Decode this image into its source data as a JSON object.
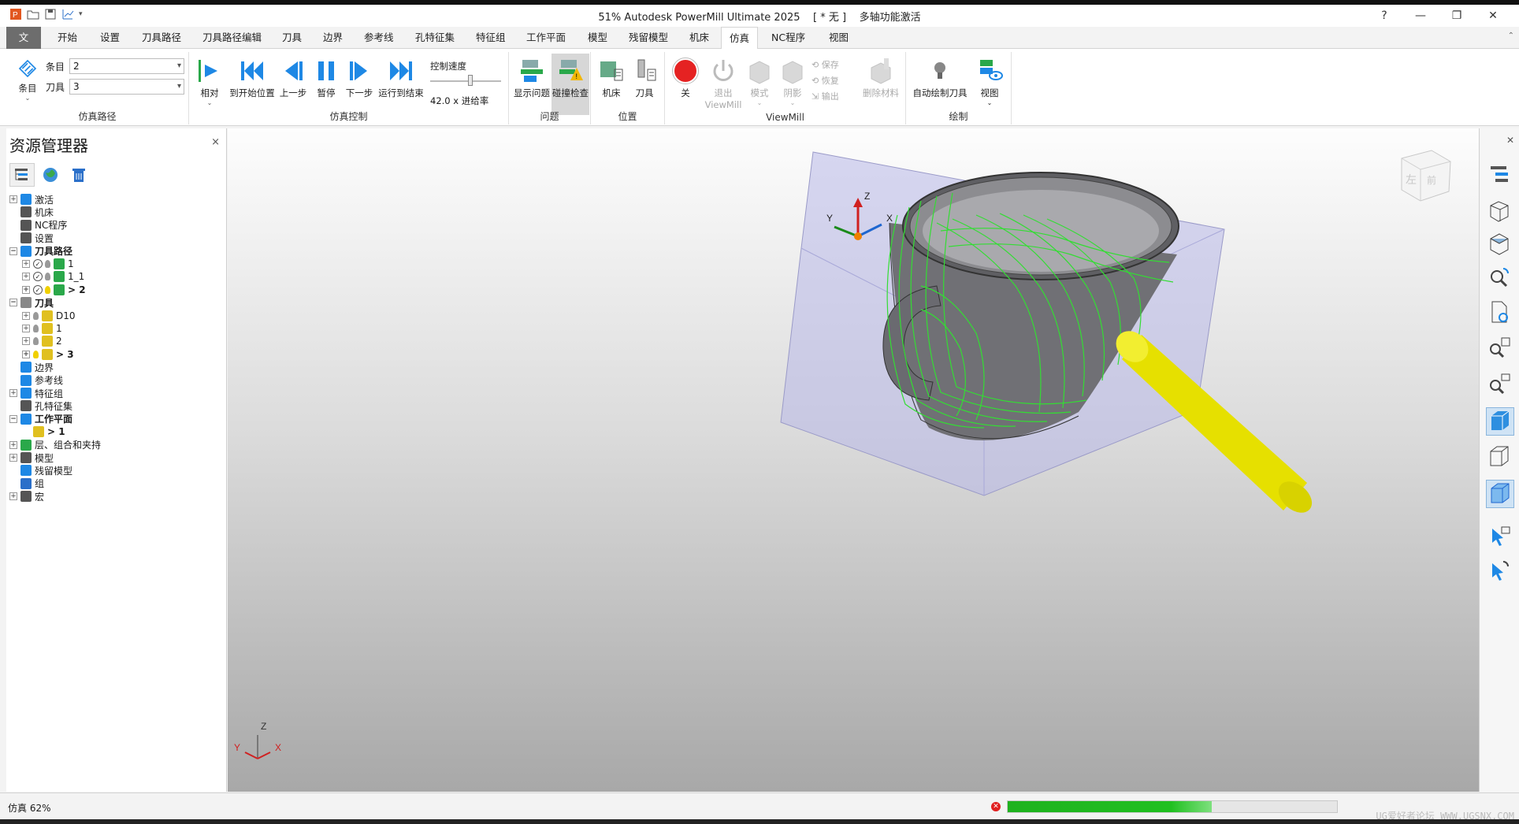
{
  "window": {
    "title": "51% Autodesk PowerMill Ultimate 2025",
    "project": "[ * 无 ]",
    "mode": "多轴功能激活",
    "controls": [
      "?",
      "—",
      "❐",
      "✕"
    ]
  },
  "tabs": [
    "文件",
    "开始",
    "设置",
    "刀具路径",
    "刀具路径编辑",
    "刀具",
    "边界",
    "参考线",
    "孔特征集",
    "特征组",
    "工作平面",
    "模型",
    "残留模型",
    "机床",
    "仿真",
    "NC程序",
    "视图"
  ],
  "active_tab": "仿真",
  "ribbon": {
    "sim_path": {
      "label": "仿真路径",
      "entity_button": "条目",
      "entity_label": "条目",
      "entity_value": "2",
      "tool_label": "刀具",
      "tool_value": "3"
    },
    "sim_control": {
      "label": "仿真控制",
      "relative": "相对",
      "to_start": "到开始位置",
      "prev": "上一步",
      "pause": "暂停",
      "next": "下一步",
      "run_to_end": "运行到结束",
      "speed_label": "控制速度",
      "speed_value": "42.0 x 进给率"
    },
    "problems": {
      "label": "问题",
      "show_problems": "显示问题",
      "collision_check": "碰撞检查"
    },
    "position": {
      "label": "位置",
      "machine": "机床",
      "tool": "刀具"
    },
    "viewmill": {
      "label": "ViewMill",
      "off": "关",
      "exit": "退出",
      "exit2": "ViewMill",
      "mode": "模式",
      "shade": "阴影",
      "save": "保存",
      "restore": "恢复",
      "export": "输出",
      "remove_material": "删除材料"
    },
    "draw": {
      "label": "绘制",
      "auto_draw_tool": "自动绘制刀具",
      "view": "视图"
    }
  },
  "explorer": {
    "title": "资源管理器",
    "close": "×",
    "tree": [
      {
        "label": "激活",
        "level": 0,
        "exp": "+",
        "bold": false
      },
      {
        "label": "机床",
        "level": 0,
        "exp": "",
        "bold": false
      },
      {
        "label": "NC程序",
        "level": 0,
        "exp": "",
        "bold": false
      },
      {
        "label": "设置",
        "level": 0,
        "exp": "",
        "bold": false
      },
      {
        "label": "刀具路径",
        "level": 0,
        "exp": "−",
        "bold": true
      },
      {
        "label": "1",
        "level": 1,
        "exp": "+",
        "bold": false
      },
      {
        "label": "1_1",
        "level": 1,
        "exp": "+",
        "bold": false
      },
      {
        "label": "> 2",
        "level": 1,
        "exp": "+",
        "bold": true
      },
      {
        "label": "刀具",
        "level": 0,
        "exp": "−",
        "bold": true
      },
      {
        "label": "D10",
        "level": 1,
        "exp": "+",
        "bold": false
      },
      {
        "label": "1",
        "level": 1,
        "exp": "+",
        "bold": false
      },
      {
        "label": "2",
        "level": 1,
        "exp": "+",
        "bold": false
      },
      {
        "label": "> 3",
        "level": 1,
        "exp": "+",
        "bold": true
      },
      {
        "label": "边界",
        "level": 0,
        "exp": "",
        "bold": false
      },
      {
        "label": "参考线",
        "level": 0,
        "exp": "",
        "bold": false
      },
      {
        "label": "特征组",
        "level": 0,
        "exp": "+",
        "bold": false
      },
      {
        "label": "孔特征集",
        "level": 0,
        "exp": "",
        "bold": false
      },
      {
        "label": "工作平面",
        "level": 0,
        "exp": "−",
        "bold": true
      },
      {
        "label": "> 1",
        "level": 1,
        "exp": "",
        "bold": true
      },
      {
        "label": "层、组合和夹持",
        "level": 0,
        "exp": "+",
        "bold": false
      },
      {
        "label": "模型",
        "level": 0,
        "exp": "+",
        "bold": false
      },
      {
        "label": "残留模型",
        "level": 0,
        "exp": "",
        "bold": false
      },
      {
        "label": "组",
        "level": 0,
        "exp": "",
        "bold": false
      },
      {
        "label": "宏",
        "level": 0,
        "exp": "+",
        "bold": false
      }
    ]
  },
  "viewport": {
    "axis_labels": {
      "x": "X",
      "y": "Y",
      "z": "Z"
    },
    "triad_labels": {
      "x": "X",
      "y": "Y",
      "z": "Z"
    },
    "viewcube_labels": {
      "left": "左",
      "front": "前"
    }
  },
  "status": {
    "text": "仿真 62%",
    "progress": 0.62,
    "watermark": "UG爱好者论坛 WWW.UGSNX.COM"
  },
  "colors": {
    "accent": "#1e88e5",
    "file_tab": "#6d6d6d",
    "progress": "#1fb21f",
    "tool": "#e6e000",
    "toolpath": "#33dd33"
  }
}
